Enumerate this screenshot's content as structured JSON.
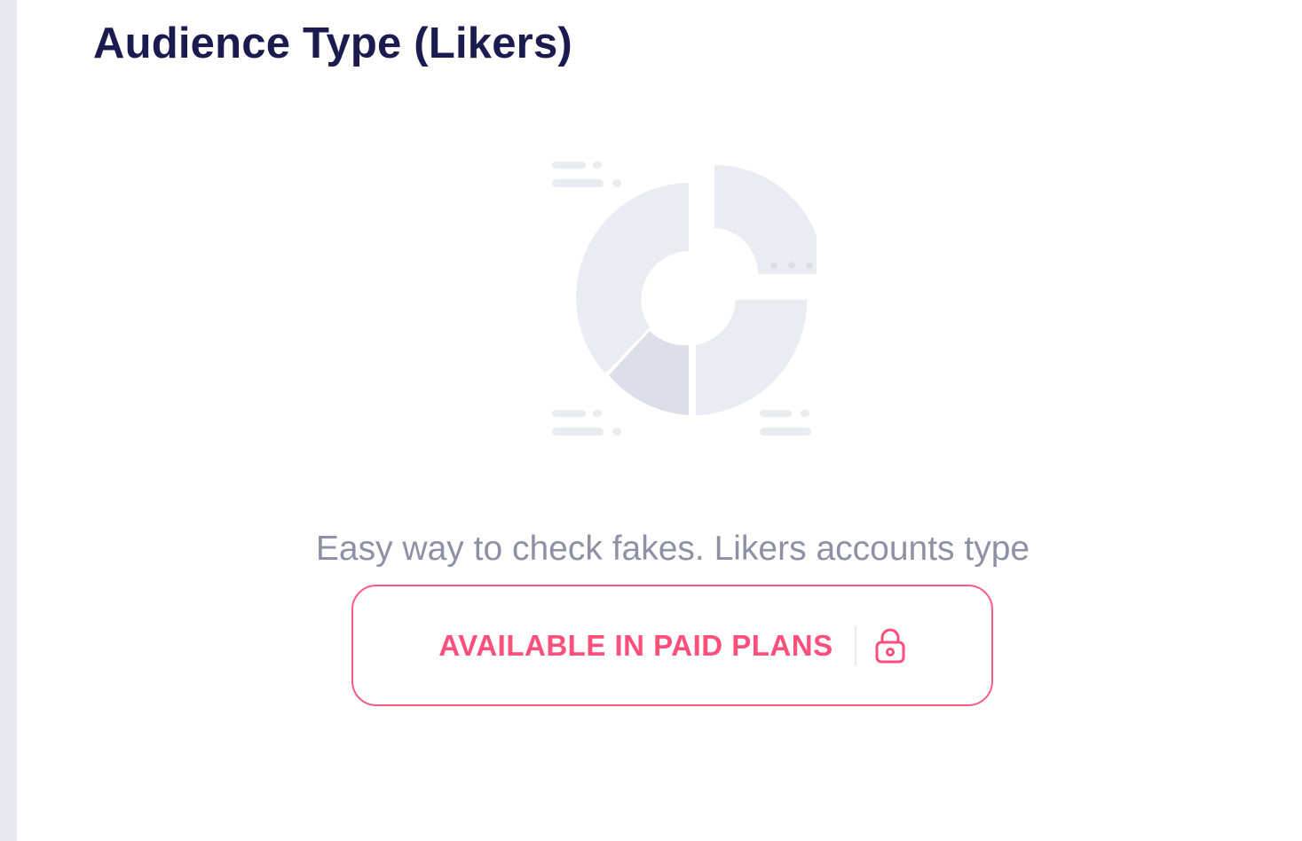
{
  "card": {
    "title": "Audience Type (Likers)",
    "description": "Easy way to check fakes. Likers accounts type",
    "cta_label": "AVAILABLE IN PAID PLANS",
    "cta_icon": "lock-icon"
  },
  "colors": {
    "title": "#1b1b4f",
    "description": "#8e91a6",
    "accent": "#ff4f7a",
    "placeholder": "#ebecf2",
    "placeholder_dark": "#dcdfe9",
    "rail": "#e8e9ef"
  },
  "placeholder_graphic": {
    "type": "donut-chart-placeholder"
  }
}
